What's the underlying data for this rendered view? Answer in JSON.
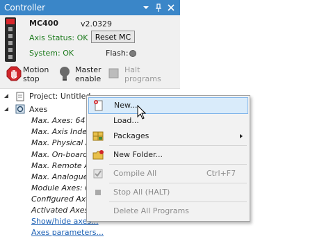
{
  "window": {
    "title": "Controller"
  },
  "controller": {
    "name": "MC400",
    "version": "v2.0329",
    "axis_status": "Axis Status: OK",
    "reset_label": "Reset MC",
    "system_status": "System: OK",
    "flash_label": "Flash:"
  },
  "toolbar": {
    "motion_stop": "Motion\nstop",
    "master_enable": "Master\nenable",
    "halt_programs": "Halt\nprograms"
  },
  "tree": {
    "project": "Project: Untitled",
    "axes": "Axes",
    "axes_children": [
      "Max. Axes: 64",
      "Max. Axis Index",
      "Max. Physical A",
      "Max. On-board",
      "Max. Remote A",
      "Max. Analogue",
      "Module Axes: 0",
      "Configured Axe",
      "Activated Axes"
    ],
    "show_hide_axes": "Show/hide axes...",
    "axes_parameters": "Axes parameters..."
  },
  "context_menu": {
    "items": [
      {
        "label": "New...",
        "shortcut": "",
        "icon": "new-file-icon",
        "enabled": true,
        "selected": true
      },
      {
        "label": "Load...",
        "shortcut": "",
        "icon": "",
        "enabled": true,
        "selected": false
      },
      {
        "label": "Packages",
        "shortcut": "",
        "icon": "packages-icon",
        "enabled": true,
        "selected": false
      },
      {
        "label": "New Folder...",
        "shortcut": "",
        "icon": "new-folder-icon",
        "enabled": true,
        "selected": false
      },
      {
        "label": "Compile All",
        "shortcut": "Ctrl+F7",
        "icon": "compile-icon",
        "enabled": false,
        "selected": false
      },
      {
        "label": "Stop All (HALT)",
        "shortcut": "",
        "icon": "stop-icon",
        "enabled": false,
        "selected": false
      },
      {
        "label": "Delete All Programs",
        "shortcut": "",
        "icon": "",
        "enabled": false,
        "selected": false
      }
    ]
  }
}
